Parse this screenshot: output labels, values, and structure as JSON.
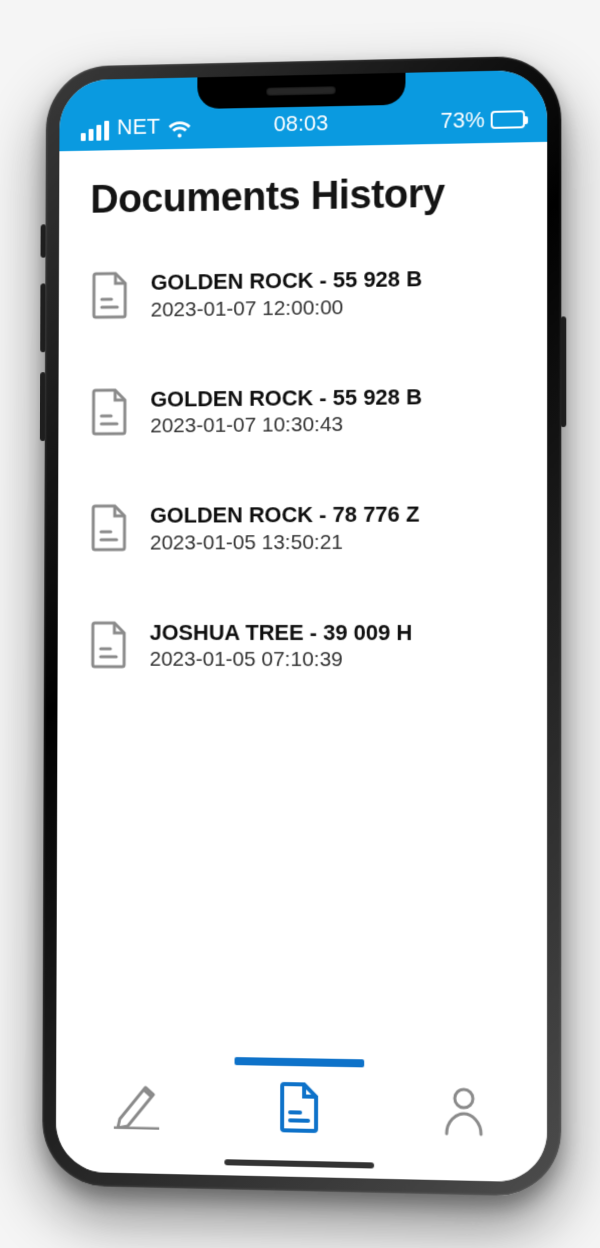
{
  "status": {
    "carrier": "NET",
    "time": "08:03",
    "battery_pct": "73%"
  },
  "page_title": "Documents History",
  "documents": [
    {
      "title": "GOLDEN ROCK - 55 928 B",
      "timestamp": "2023-01-07 12:00:00"
    },
    {
      "title": "GOLDEN ROCK - 55 928 B",
      "timestamp": "2023-01-07 10:30:43"
    },
    {
      "title": "GOLDEN ROCK - 78 776 Z",
      "timestamp": "2023-01-05 13:50:21"
    },
    {
      "title": "JOSHUA TREE - 39 009 H",
      "timestamp": "2023-01-05 07:10:39"
    }
  ],
  "nav": {
    "active_index": 1
  },
  "colors": {
    "status_bg": "#0a9ae0",
    "accent": "#0e72c9",
    "icon_grey": "#8a8a8a"
  }
}
